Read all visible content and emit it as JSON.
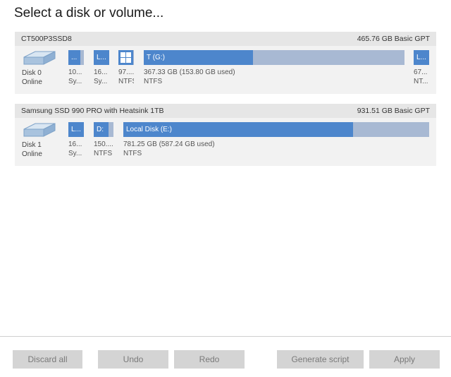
{
  "page": {
    "title": "Select a disk or volume..."
  },
  "disks": [
    {
      "model": "CT500P3SSD8",
      "size_info": "465.76 GB Basic GPT",
      "name": "Disk 0",
      "status": "Online",
      "partitions": [
        {
          "bar_label": "...",
          "line1": "10...",
          "line2": "Sy...",
          "fill": 0.75
        },
        {
          "bar_label": "L...",
          "line1": "16...",
          "line2": "Sy...",
          "fill": 1.0
        },
        {
          "bar_label": "",
          "line1": "97....",
          "line2": "NTFS",
          "fill": 1.0,
          "icon": "windows-icon"
        },
        {
          "bar_label": "T (G:)",
          "line1": "367.33 GB (153.80 GB used)",
          "line2": "NTFS",
          "fill": 0.42
        },
        {
          "bar_label": "L...",
          "line1": "67...",
          "line2": "NT...",
          "fill": 1.0
        }
      ]
    },
    {
      "model": "Samsung SSD 990 PRO with Heatsink 1TB",
      "size_info": "931.51 GB Basic GPT",
      "name": "Disk 1",
      "status": "Online",
      "partitions": [
        {
          "bar_label": "L...",
          "line1": "16...",
          "line2": "Sy...",
          "fill": 1.0
        },
        {
          "bar_label": "D:",
          "line1": "150....",
          "line2": "NTFS",
          "fill": 0.75
        },
        {
          "bar_label": "Local Disk (E:)",
          "line1": "781.25 GB (587.24 GB used)",
          "line2": "NTFS",
          "fill": 0.75
        }
      ]
    }
  ],
  "buttons": {
    "discard_all": "Discard all",
    "undo": "Undo",
    "redo": "Redo",
    "generate_script": "Generate script",
    "apply": "Apply"
  },
  "colors": {
    "partition_used": "#4d86cc",
    "partition_free": "#a8b9d3",
    "button_disabled": "#d4d4d4"
  }
}
